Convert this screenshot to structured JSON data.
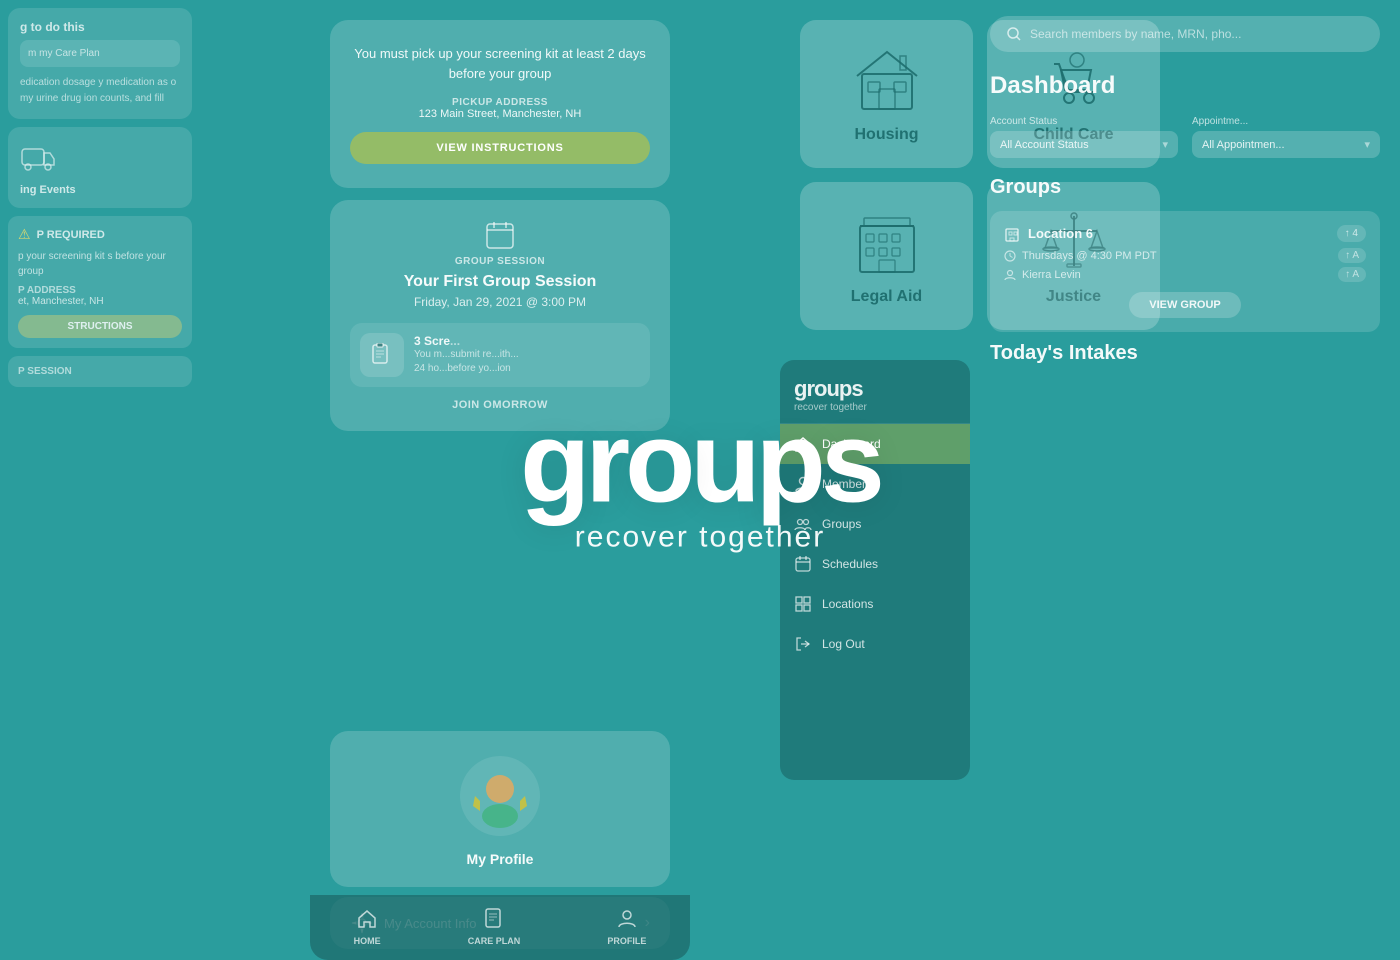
{
  "app": {
    "name": "groups",
    "tagline": "recover together"
  },
  "background": {
    "color": "#2a9d9d"
  },
  "left_panel": {
    "section_title": "g to do this",
    "care_plan_label": "m my Care Plan",
    "medication_text": "edication dosage\ny medication as\no my urine drug\nion counts, and fill",
    "upcoming_label": "ing Events",
    "warning_label": "P REQUIRED",
    "warning_text": "p your screening kit\ns before your group",
    "pickup_address_label": "P ADDRESS",
    "pickup_address": "et, Manchester, NH",
    "instructions_btn": "STRUCTIONS",
    "session_label": "P SESSION"
  },
  "phone_panel": {
    "alert_text": "You must pick up your screening kit at least 2 days before your group",
    "pickup_label": "PICKUP ADDRESS",
    "pickup_address": "123 Main Street, Manchester, NH",
    "view_instructions_btn": "VIEW INSTRUCTIONS",
    "session_section": {
      "label": "GROUP SESSION",
      "title": "Your First Group Session",
      "date": "Friday, Jan 29, 2021 @ 3:00 PM",
      "screens_count": "3 Scre...",
      "screens_desc": "You m...submit re...ith...24 ho...before yo...ion",
      "join_btn": "JOIN OMORROW"
    },
    "nav": {
      "home_label": "HOME",
      "care_plan_label": "CARE PLAN",
      "profile_label": "PROFILE"
    },
    "profile_card": {
      "title": "My Profile"
    },
    "account_card": {
      "title": "My Account Info"
    }
  },
  "resources_panel": {
    "cards": [
      {
        "label": "Housing",
        "icon": "house-icon"
      },
      {
        "label": "Child Care",
        "icon": "childcare-icon"
      },
      {
        "label": "Legal Aid",
        "icon": "building-icon"
      },
      {
        "label": "Justice",
        "icon": "justice-icon"
      }
    ]
  },
  "admin_sidebar": {
    "search_placeholder": "Search members by name, MRN, pho...",
    "nav_items": [
      {
        "label": "Dashboard",
        "active": true,
        "icon": "home-icon"
      },
      {
        "label": "Members",
        "active": false,
        "icon": "members-icon"
      },
      {
        "label": "Groups",
        "active": false,
        "icon": "groups-icon"
      },
      {
        "label": "Schedules",
        "active": false,
        "icon": "schedule-icon"
      },
      {
        "label": "Locations",
        "active": false,
        "icon": "location-icon"
      },
      {
        "label": "Log Out",
        "active": false,
        "icon": "logout-icon"
      }
    ]
  },
  "dashboard": {
    "title": "Dashboard",
    "account_status_label": "Account Status",
    "account_status_value": "All Account Status",
    "appointment_label": "Appointme...",
    "appointment_value": "All Appointmen...",
    "groups_title": "Groups",
    "group_card": {
      "location": "Location 6",
      "time": "Thursdays @ 4:30 PM PDT",
      "member": "Kierra Levin",
      "view_btn": "VIEW GROUP"
    },
    "intakes_title": "Today's Intakes"
  }
}
